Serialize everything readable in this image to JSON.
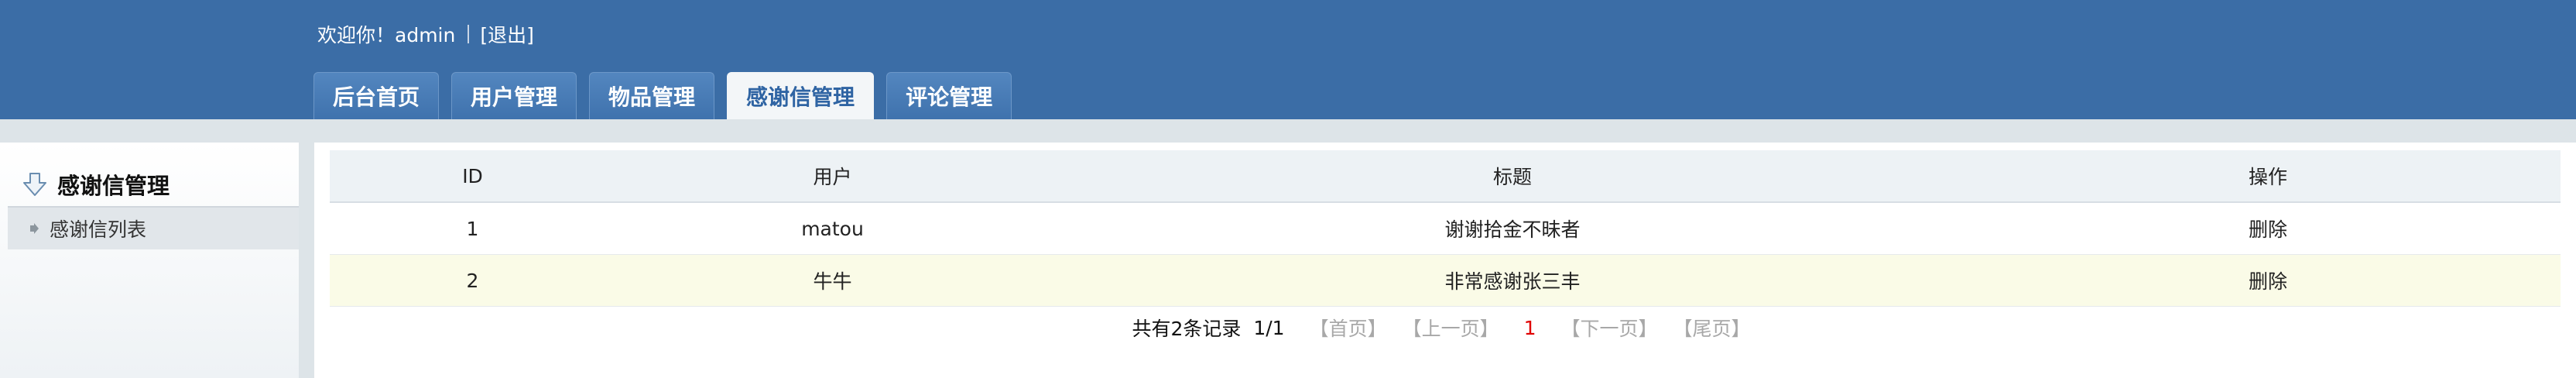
{
  "header": {
    "welcome_text": "欢迎你！admin",
    "logout_label": "[退出]",
    "tabs": [
      {
        "label": "后台首页"
      },
      {
        "label": "用户管理"
      },
      {
        "label": "物品管理"
      },
      {
        "label": "感谢信管理",
        "active": true
      },
      {
        "label": "评论管理"
      }
    ]
  },
  "sidebar": {
    "title": "感谢信管理",
    "items": [
      {
        "label": "感谢信列表"
      }
    ]
  },
  "table": {
    "columns": [
      "ID",
      "用户",
      "标题",
      "操作"
    ],
    "rows": [
      {
        "id": "1",
        "user": "matou",
        "title": "谢谢拾金不昧者",
        "action": "删除"
      },
      {
        "id": "2",
        "user": "牛牛",
        "title": "非常感谢张三丰",
        "action": "删除"
      }
    ]
  },
  "pagination": {
    "total_text": "共有2条记录",
    "page_info": "1/1",
    "first_label": "【首页】",
    "prev_label": "【上一页】",
    "current_page": "1",
    "next_label": "【下一页】",
    "last_label": "【尾页】"
  },
  "colors": {
    "header_bg": "#3b6da6",
    "active_tab_text": "#2f64a3",
    "current_page": "#e00000",
    "alt_row_bg": "#fafbe7"
  }
}
